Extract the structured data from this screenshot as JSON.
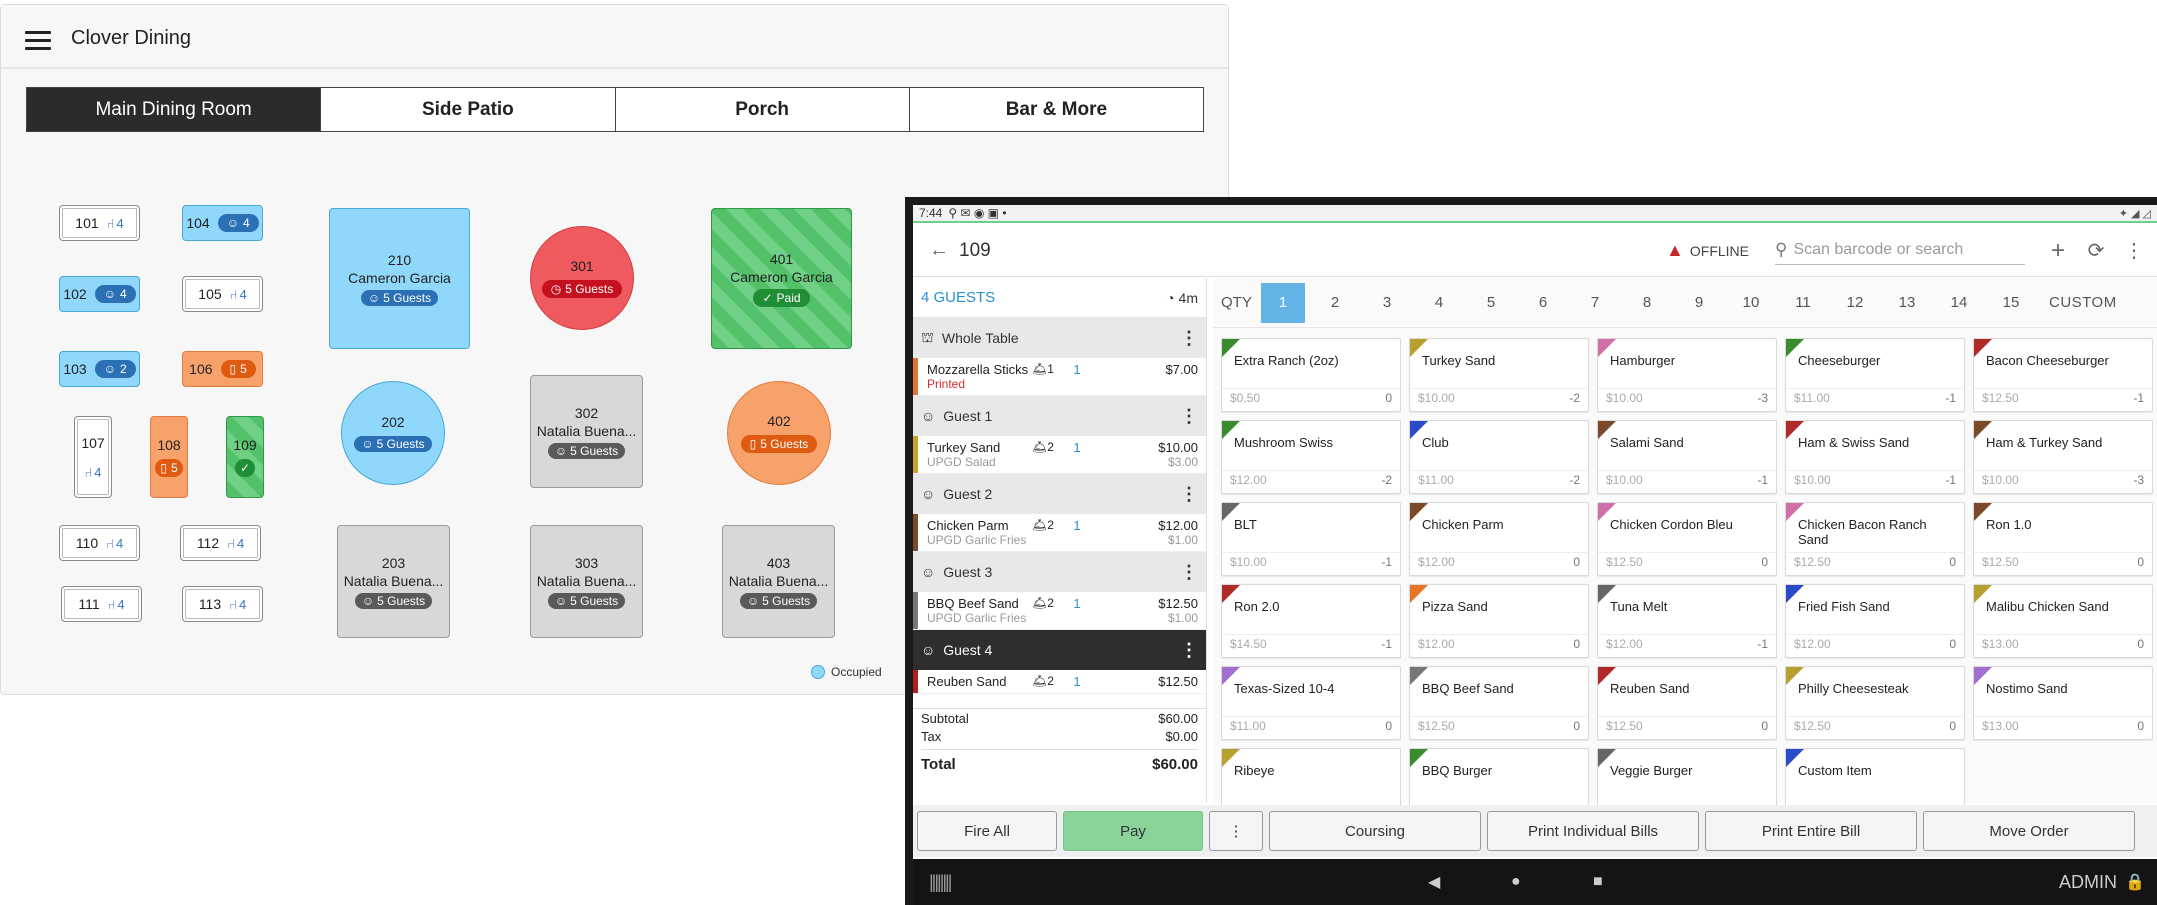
{
  "floor": {
    "title": "Clover Dining",
    "tabs": [
      "Main Dining Room",
      "Side Patio",
      "Porch",
      "Bar & More"
    ],
    "tables": {
      "t101": {
        "num": "101",
        "seats": "4"
      },
      "t104": {
        "num": "104",
        "seats": "4"
      },
      "t102": {
        "num": "102",
        "seats": "4"
      },
      "t105": {
        "num": "105",
        "seats": "4"
      },
      "t103": {
        "num": "103",
        "seats": "2"
      },
      "t106": {
        "num": "106",
        "seats": "5"
      },
      "t107": {
        "num": "107",
        "seats": "4"
      },
      "t108": {
        "num": "108",
        "seats": "5"
      },
      "t109": {
        "num": "109"
      },
      "t110": {
        "num": "110",
        "seats": "4"
      },
      "t112": {
        "num": "112",
        "seats": "4"
      },
      "t111": {
        "num": "111",
        "seats": "4"
      },
      "t113": {
        "num": "113",
        "seats": "4"
      },
      "t210": {
        "num": "210",
        "name": "Cameron Garcia",
        "badge": "5 Guests"
      },
      "t202": {
        "num": "202",
        "badge": "5 Guests"
      },
      "t203": {
        "num": "203",
        "name": "Natalia Buena...",
        "badge": "5 Guests"
      },
      "t301": {
        "num": "301",
        "badge": "5 Guests"
      },
      "t302": {
        "num": "302",
        "name": "Natalia Buena...",
        "badge": "5 Guests"
      },
      "t303": {
        "num": "303",
        "name": "Natalia Buena...",
        "badge": "5 Guests"
      },
      "t401": {
        "num": "401",
        "name": "Cameron Garcia",
        "badge": "Paid"
      },
      "t402": {
        "num": "402",
        "badge": "5 Guests"
      },
      "t403": {
        "num": "403",
        "name": "Natalia Buena...",
        "badge": "5 Guests"
      }
    },
    "legend": "Occupied"
  },
  "pos": {
    "status_time": "7:44",
    "order_number": "109",
    "offline_label": "OFFLINE",
    "search_placeholder": "Scan barcode or search",
    "guests_label": "4 GUESTS",
    "timer": "4m",
    "sections": [
      {
        "label": "Whole Table",
        "lines": [
          {
            "name": "Mozzarella Sticks",
            "course": "1",
            "qty": "1",
            "price": "$7.00",
            "status": "Printed",
            "color": "#e8742a"
          }
        ]
      },
      {
        "label": "Guest 1",
        "lines": [
          {
            "name": "Turkey Sand",
            "course": "2",
            "qty": "1",
            "price": "$10.00",
            "mod": "UPGD Salad",
            "mod_price": "$3.00",
            "color": "#c9a227"
          }
        ]
      },
      {
        "label": "Guest 2",
        "lines": [
          {
            "name": "Chicken Parm",
            "course": "2",
            "qty": "1",
            "price": "$12.00",
            "mod": "UPGD Garlic Fries",
            "mod_price": "$1.00",
            "color": "#7a4a2a"
          }
        ]
      },
      {
        "label": "Guest 3",
        "lines": [
          {
            "name": "BBQ Beef Sand",
            "course": "2",
            "qty": "1",
            "price": "$12.50",
            "mod": "UPGD Garlic Fries",
            "mod_price": "$1.00",
            "color": "#777777"
          }
        ]
      },
      {
        "label": "Guest 4",
        "lines": [
          {
            "name": "Reuben Sand",
            "course": "2",
            "qty": "1",
            "price": "$12.50",
            "color": "#b71c1c"
          }
        ]
      }
    ],
    "subtotal_label": "Subtotal",
    "subtotal": "$60.00",
    "tax_label": "Tax",
    "tax": "$0.00",
    "total_label": "Total",
    "total": "$60.00",
    "qty_label": "QTY",
    "qty_values": [
      "1",
      "2",
      "3",
      "4",
      "5",
      "6",
      "7",
      "8",
      "9",
      "10",
      "11",
      "12",
      "13",
      "14",
      "15"
    ],
    "qty_custom": "CUSTOM",
    "items": [
      {
        "name": "Extra Ranch (2oz)",
        "price": "$0.50",
        "count": "0",
        "color": "#3a8a2e"
      },
      {
        "name": "Turkey Sand",
        "price": "$10.00",
        "count": "-2",
        "color": "#b8a030"
      },
      {
        "name": "Hamburger",
        "price": "$10.00",
        "count": "-3",
        "color": "#d070a8"
      },
      {
        "name": "Cheeseburger",
        "price": "$11.00",
        "count": "-1",
        "color": "#3a8a2e"
      },
      {
        "name": "Bacon Cheeseburger",
        "price": "$12.50",
        "count": "-1",
        "color": "#b02a2a"
      },
      {
        "name": "Mushroom Swiss",
        "price": "$12.00",
        "count": "-2",
        "color": "#3a8a2e"
      },
      {
        "name": "Club",
        "price": "$11.00",
        "count": "-2",
        "color": "#2a4ac8"
      },
      {
        "name": "Salami Sand",
        "price": "$10.00",
        "count": "-1",
        "color": "#7a4a2a"
      },
      {
        "name": "Ham & Swiss Sand",
        "price": "$10.00",
        "count": "-1",
        "color": "#b02a2a"
      },
      {
        "name": "Ham & Turkey Sand",
        "price": "$10.00",
        "count": "-3",
        "color": "#7a4a2a"
      },
      {
        "name": "BLT",
        "price": "$10.00",
        "count": "-1",
        "color": "#666666"
      },
      {
        "name": "Chicken Parm",
        "price": "$12.00",
        "count": "0",
        "color": "#7a4a2a"
      },
      {
        "name": "Chicken Cordon Bleu",
        "price": "$12.50",
        "count": "0",
        "color": "#d070a8"
      },
      {
        "name": "Chicken Bacon Ranch Sand",
        "price": "$12.50",
        "count": "0",
        "color": "#d070a8"
      },
      {
        "name": "Ron 1.0",
        "price": "$12.50",
        "count": "0",
        "color": "#7a4a2a"
      },
      {
        "name": "Ron 2.0",
        "price": "$14.50",
        "count": "-1",
        "color": "#b02a2a"
      },
      {
        "name": "Pizza Sand",
        "price": "$12.00",
        "count": "0",
        "color": "#e8742a"
      },
      {
        "name": "Tuna Melt",
        "price": "$12.00",
        "count": "-1",
        "color": "#666666"
      },
      {
        "name": "Fried Fish Sand",
        "price": "$12.00",
        "count": "0",
        "color": "#2a4ac8"
      },
      {
        "name": "Malibu Chicken Sand",
        "price": "$13.00",
        "count": "0",
        "color": "#b8a030"
      },
      {
        "name": "Texas-Sized 10-4",
        "price": "$11.00",
        "count": "0",
        "color": "#a070d0"
      },
      {
        "name": "BBQ Beef Sand",
        "price": "$12.50",
        "count": "0",
        "color": "#777777"
      },
      {
        "name": "Reuben Sand",
        "price": "$12.50",
        "count": "0",
        "color": "#b02a2a"
      },
      {
        "name": "Philly Cheesesteak",
        "price": "$12.50",
        "count": "0",
        "color": "#b8a030"
      },
      {
        "name": "Nostimo Sand",
        "price": "$13.00",
        "count": "0",
        "color": "#a070d0"
      },
      {
        "name": "Ribeye",
        "price": "",
        "count": "",
        "color": "#b8a030"
      },
      {
        "name": "BBQ Burger",
        "price": "",
        "count": "",
        "color": "#3a8a2e"
      },
      {
        "name": "Veggie Burger",
        "price": "",
        "count": "",
        "color": "#666666"
      },
      {
        "name": "Custom Item",
        "price": "",
        "count": "",
        "color": "#2a4ac8"
      }
    ],
    "actions": {
      "fire_all": "Fire All",
      "pay": "Pay",
      "more": "⋮",
      "coursing": "Coursing",
      "print_individual": "Print Individual Bills",
      "print_entire": "Print Entire Bill",
      "move_order": "Move Order"
    },
    "admin_label": "ADMIN"
  }
}
